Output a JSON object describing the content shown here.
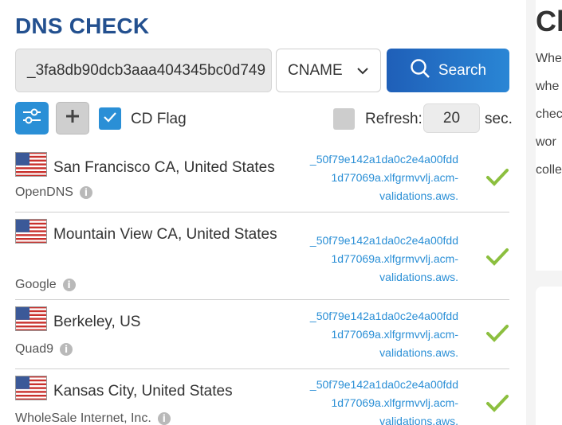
{
  "header": {
    "title": "DNS CHECK"
  },
  "search": {
    "value": "_3fa8db90dcb3aaa404345bc0d749",
    "record_type": "CNAME",
    "button_label": "Search"
  },
  "options": {
    "cd_flag_label": "CD Flag",
    "cd_flag_checked": true,
    "refresh_label": "Refresh:",
    "refresh_value": "20",
    "refresh_unit": "sec.",
    "refresh_checked": false
  },
  "results": [
    {
      "location": "San Francisco CA, United States",
      "provider": "OpenDNS",
      "record_lines": [
        "_50f79e142a1da0c2e4a00fdd",
        "1d77069a.xlfgrmvvlj.acm-",
        "validations.aws."
      ],
      "status": "ok"
    },
    {
      "location": "Mountain View CA, United States",
      "provider": "Google",
      "record_lines": [
        "_50f79e142a1da0c2e4a00fdd",
        "1d77069a.xlfgrmvvlj.acm-",
        "validations.aws."
      ],
      "status": "ok"
    },
    {
      "location": "Berkeley, US",
      "provider": "Quad9",
      "record_lines": [
        "_50f79e142a1da0c2e4a00fdd",
        "1d77069a.xlfgrmvvlj.acm-",
        "validations.aws."
      ],
      "status": "ok"
    },
    {
      "location": "Kansas City, United States",
      "provider": "WholeSale Internet, Inc.",
      "record_lines": [
        "_50f79e142a1da0c2e4a00fdd",
        "1d77069a.xlfgrmvvlj.acm-",
        "validations.aws."
      ],
      "status": "ok"
    }
  ],
  "side_panel": {
    "title": "Ch",
    "lines": [
      "Whe",
      "whe",
      "chec",
      "wor",
      "colle"
    ]
  },
  "colors": {
    "title": "#23508f",
    "accent": "#2a8fd6",
    "link": "#2a8fd6",
    "check": "#8cbf3f"
  },
  "icons": {
    "settings": "sliders-icon",
    "add": "plus-icon",
    "search": "magnifier-icon",
    "dropdown": "chevron-down-icon",
    "info": "info-icon",
    "status": "checkmark-icon",
    "flag": "us-flag-icon"
  }
}
